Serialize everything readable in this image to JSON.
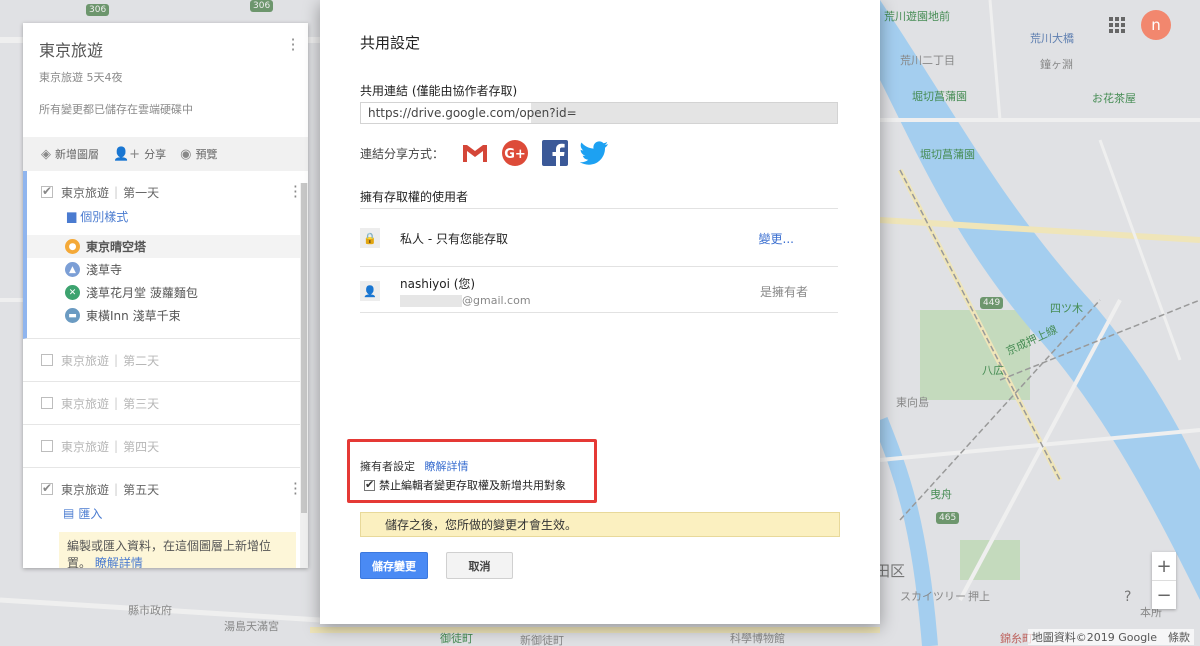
{
  "left_panel": {
    "title": "東京旅遊",
    "subtitle": "東京旅遊 5天4夜",
    "saved_status": "所有變更都已儲存在雲端硬碟中",
    "toolbar": {
      "add_layer": "新增圖層",
      "share": "分享",
      "preview": "預覽"
    },
    "layers": [
      {
        "name": "東京旅遊",
        "day": "第一天",
        "checked": true
      },
      {
        "name": "東京旅遊",
        "day": "第二天",
        "checked": false
      },
      {
        "name": "東京旅遊",
        "day": "第三天",
        "checked": false
      },
      {
        "name": "東京旅遊",
        "day": "第四天",
        "checked": false
      },
      {
        "name": "東京旅遊",
        "day": "第五天",
        "checked": true
      }
    ],
    "style_link": "個別樣式",
    "places": [
      {
        "name": "東京晴空塔",
        "color": "#f4a938"
      },
      {
        "name": "淺草寺",
        "color": "#7c9fd6"
      },
      {
        "name": "淺草花月堂 菠蘿麵包",
        "color": "#3da36f"
      },
      {
        "name": "東橫Inn 淺草千束",
        "color": "#6b9bc2"
      }
    ],
    "import_link": "匯入",
    "info_text": "編製或匯入資料，在這個圖層上新增位置。",
    "info_link": "瞭解詳情"
  },
  "modal": {
    "title": "共用設定",
    "share_link_label": "共用連結 (僅能由協作者存取)",
    "share_link_value": "https://drive.google.com/open?id=",
    "share_via_label": "連結分享方式：",
    "access_label": "擁有存取權的使用者",
    "private_label": "私人 - 只有您能存取",
    "change_link": "變更...",
    "user_name": "nashiyoi (您)",
    "user_email_domain": "@gmail.com",
    "owner_role": "是擁有者",
    "owner_settings_label": "擁有者設定",
    "owner_learn_more": "瞭解詳情",
    "prevent_editors_label": "禁止編輯者變更存取權及新增共用對象",
    "prevent_editors_checked": true,
    "notice": "儲存之後，您所做的變更才會生效。",
    "save_button": "儲存變更",
    "cancel_button": "取消"
  },
  "header": {
    "avatar_letter": "n"
  },
  "map": {
    "labels": {
      "l306a": "306",
      "l306b": "306",
      "arakawa_yuen": "荒川遊園地前",
      "arakawa_nichome": "荒川二丁目",
      "arakawa_ohashi": "荒川大橋",
      "horikiri_a": "堀切菖蒲園",
      "horikiri_b": "堀切菖蒲園",
      "ochajaya": "お花茶屋",
      "keisei_oshiage": "京成押上線",
      "yotsugi": "四ツ木",
      "hachiko": "八広",
      "higashimukojima": "東向島",
      "kanegafuchi": "鐘ヶ淵",
      "l449": "449",
      "l465": "465",
      "hikifune": "曳舟",
      "sumida_ku": "墨田区",
      "skytree": "スカイツリー",
      "oshiage": "押上",
      "kinshicho": "錦糸町",
      "kagaku": "科學博物館",
      "honjo": "本所",
      "okachimachi": "御徒町",
      "shinokachimachi": "新御徒町",
      "yushima": "湯島天滿宮",
      "kenchosei": "縣市政府"
    },
    "attribution": "地圖資料©2019 Google　條款"
  },
  "colors": {
    "accent_blue": "#4a8af4",
    "link_blue": "#3b6fd0",
    "highlight_red": "#e53935",
    "notice_yellow": "#fbf0c0",
    "avatar": "#f2876e"
  },
  "icons": [
    "layers-icon",
    "person-add-icon",
    "eye-icon",
    "checkbox-icon",
    "paint-roller-icon",
    "lock-icon",
    "person-icon",
    "gmail-icon",
    "google-plus-icon",
    "facebook-icon",
    "twitter-icon",
    "apps-grid-icon",
    "zoom-in-icon",
    "zoom-out-icon",
    "help-icon"
  ]
}
